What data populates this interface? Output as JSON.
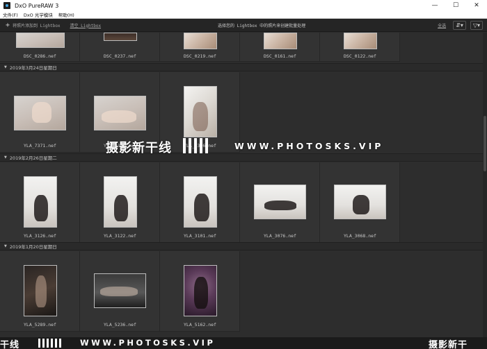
{
  "window": {
    "title": "DxO PureRAW 3",
    "minimize_glyph": "—",
    "maximize_glyph": "☐",
    "close_glyph": "✕"
  },
  "menu": [
    "文件(F)",
    "DxO 光学模块",
    "帮助(H)"
  ],
  "toolbar": {
    "add_label": "将照片添加到 Lightbox",
    "clear_label": "清空 Lightbox",
    "center_text": "选择您的 Lightbox 中的照片来创建批量处理",
    "select_label": "全选",
    "sort_glyph": "⇵▾",
    "filter_glyph": "▽▾"
  },
  "groups": [
    {
      "label": "",
      "items": [
        "DSC_0286.nef",
        "DSC_0237.nef",
        "DSC_0219.nef",
        "DSC_0161.nef",
        "DSC_0122.nef"
      ]
    },
    {
      "label": "2019年3月24日星期日",
      "items": [
        "YLA_7371.nef",
        "YLA_7332.nef",
        "YLA_7316.nef"
      ]
    },
    {
      "label": "2019年2月26日星期二",
      "items": [
        "YLA_3126.nef",
        "YLA_3122.nef",
        "YLA_3101.nef",
        "YLA_3076.nef",
        "YLA_3068.nef"
      ]
    },
    {
      "label": "2019年1月20日星期日",
      "items": [
        "YLA_5289.nef",
        "YLA_5236.nef",
        "YLA_5162.nef"
      ]
    }
  ],
  "watermark": {
    "brand": "摄影新干线",
    "url": "WWW.PHOTOSKS.VIP",
    "bottom_left": "干线",
    "bottom_right": "摄影新干"
  },
  "colors": {
    "background": "#2b2b2b",
    "cell": "#333333",
    "titlebar": "#ffffff"
  }
}
